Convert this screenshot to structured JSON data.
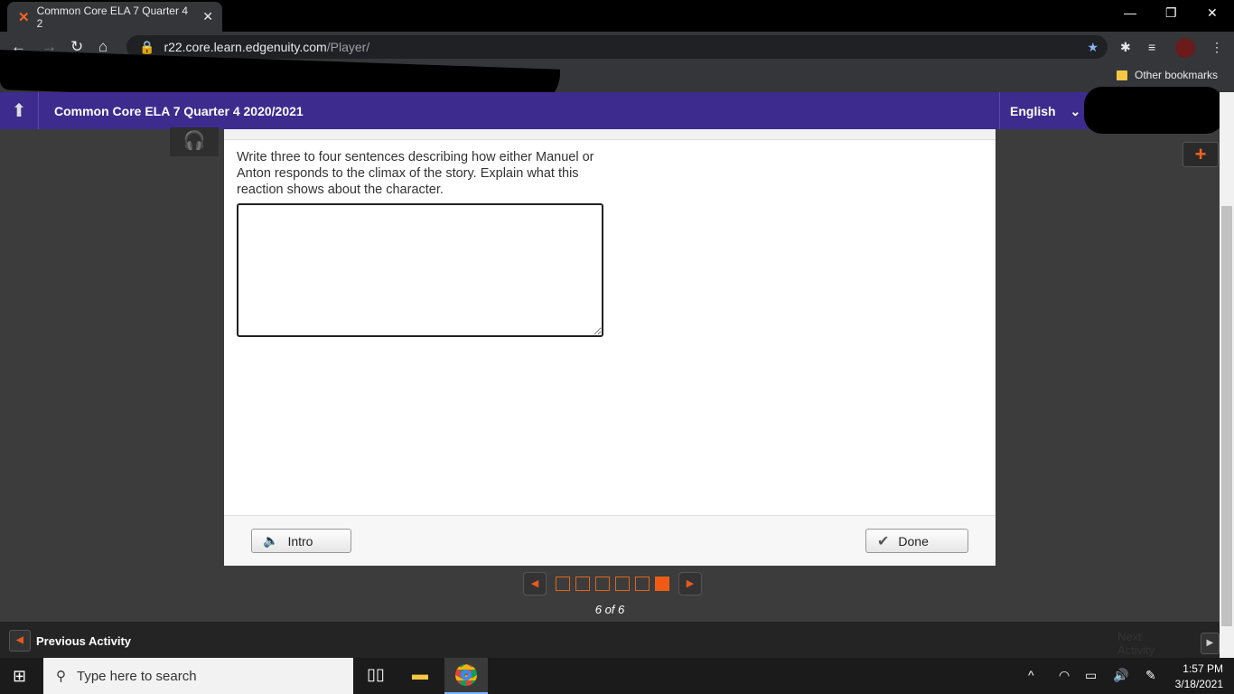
{
  "browser": {
    "tab_title": "Common Core ELA 7 Quarter 4 2",
    "url_host": "r22.core.learn.edgenuity.com",
    "url_path": "/Player/",
    "other_bookmarks": "Other bookmarks"
  },
  "header": {
    "course_title": "Common Core ELA 7 Quarter 4 2020/2021",
    "language": "English"
  },
  "question": {
    "prompt": "Write three to four sentences describing how either Manuel or Anton responds to the climax of the story. Explain what this reaction shows about the character.",
    "answer": ""
  },
  "buttons": {
    "intro": "Intro",
    "done": "Done"
  },
  "pager": {
    "current": 6,
    "total": 6,
    "label": "6 of 6"
  },
  "nav": {
    "previous": "Previous Activity",
    "next": "Next Activity"
  },
  "taskbar": {
    "search_placeholder": "Type here to search",
    "time": "1:57 PM",
    "date": "3/18/2021"
  },
  "colors": {
    "header": "#3d2b8e",
    "accent": "#f05a14"
  }
}
